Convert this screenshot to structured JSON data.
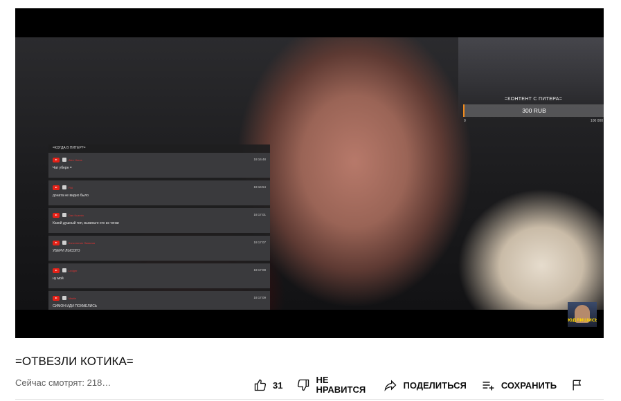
{
  "video": {
    "chat": {
      "title": "=КОГДА В ПИТЕР?=",
      "messages": [
        {
          "author": "Alex Horus",
          "time": "19:16:48",
          "text": "Чат уберн ="
        },
        {
          "author": "Fiki",
          "time": "19:16:54",
          "text": "доната не видно было"
        },
        {
          "author": "Dan Kuzmin",
          "time": "19:17:01",
          "text": "Какой душный тип, выкиньте его из тачки"
        },
        {
          "author": "Константин Ливанов",
          "time": "19:17:07",
          "text": "УБЕРИ ЛЫСОГО"
        },
        {
          "author": "Ledger",
          "time": "19:17:08",
          "text": "ну мой"
        },
        {
          "author": "Martin",
          "time": "19:17:09",
          "text": "СИМОН ИДИ ПОХМЕЛИСЬ"
        }
      ]
    },
    "counter": {
      "title": "=КОНТЕНТ С ПИТЕРА=",
      "amount": "300 RUB",
      "min": "0",
      "max": "100 000",
      "progress_fraction": 0.003
    },
    "corner_thumb_label": "ЮДЛИШИСЬ"
  },
  "title": "=ОТВЕЗЛИ КОТИКА=",
  "viewers": "Сейчас смотрят: 218…",
  "actions": {
    "like_count": "31",
    "dislike_label": "НЕ НРАВИТСЯ",
    "share_label": "ПОДЕЛИТЬСЯ",
    "save_label": "СОХРАНИТЬ"
  },
  "icons": {
    "like": "thumb-up-icon",
    "dislike": "thumb-down-icon",
    "share": "share-arrow-icon",
    "save": "playlist-add-icon",
    "report": "flag-icon"
  },
  "colors": {
    "youtube_red": "#e62117",
    "counter_accent": "#f08a1c"
  }
}
